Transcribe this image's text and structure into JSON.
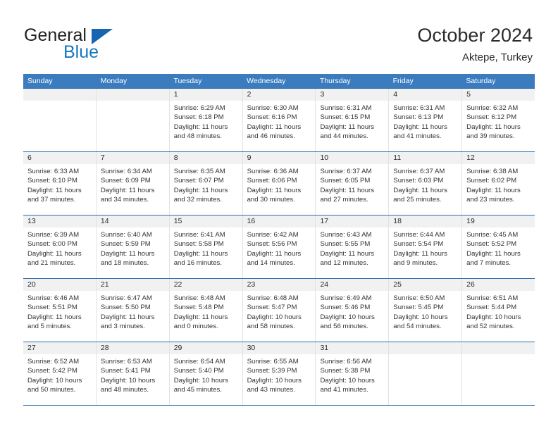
{
  "brand": {
    "name_top": "General",
    "name_bottom": "Blue"
  },
  "header": {
    "title": "October 2024",
    "subtitle": "Aktepe, Turkey"
  },
  "colors": {
    "header_blue": "#3b7cbf",
    "row_divider_blue": "#2f6daf",
    "daynum_background": "#f1f1f1",
    "logo_blue": "#1677bd",
    "text": "#333333"
  },
  "weekdays": [
    "Sunday",
    "Monday",
    "Tuesday",
    "Wednesday",
    "Thursday",
    "Friday",
    "Saturday"
  ],
  "labels": {
    "sunrise_prefix": "Sunrise: ",
    "sunset_prefix": "Sunset: ",
    "daylight_prefix": "Daylight: "
  },
  "weeks": [
    [
      {
        "day": "",
        "empty": true
      },
      {
        "day": "",
        "empty": true
      },
      {
        "day": "1",
        "sunrise": "Sunrise: 6:29 AM",
        "sunset": "Sunset: 6:18 PM",
        "daylight1": "Daylight: 11 hours",
        "daylight2": "and 48 minutes."
      },
      {
        "day": "2",
        "sunrise": "Sunrise: 6:30 AM",
        "sunset": "Sunset: 6:16 PM",
        "daylight1": "Daylight: 11 hours",
        "daylight2": "and 46 minutes."
      },
      {
        "day": "3",
        "sunrise": "Sunrise: 6:31 AM",
        "sunset": "Sunset: 6:15 PM",
        "daylight1": "Daylight: 11 hours",
        "daylight2": "and 44 minutes."
      },
      {
        "day": "4",
        "sunrise": "Sunrise: 6:31 AM",
        "sunset": "Sunset: 6:13 PM",
        "daylight1": "Daylight: 11 hours",
        "daylight2": "and 41 minutes."
      },
      {
        "day": "5",
        "sunrise": "Sunrise: 6:32 AM",
        "sunset": "Sunset: 6:12 PM",
        "daylight1": "Daylight: 11 hours",
        "daylight2": "and 39 minutes."
      }
    ],
    [
      {
        "day": "6",
        "sunrise": "Sunrise: 6:33 AM",
        "sunset": "Sunset: 6:10 PM",
        "daylight1": "Daylight: 11 hours",
        "daylight2": "and 37 minutes."
      },
      {
        "day": "7",
        "sunrise": "Sunrise: 6:34 AM",
        "sunset": "Sunset: 6:09 PM",
        "daylight1": "Daylight: 11 hours",
        "daylight2": "and 34 minutes."
      },
      {
        "day": "8",
        "sunrise": "Sunrise: 6:35 AM",
        "sunset": "Sunset: 6:07 PM",
        "daylight1": "Daylight: 11 hours",
        "daylight2": "and 32 minutes."
      },
      {
        "day": "9",
        "sunrise": "Sunrise: 6:36 AM",
        "sunset": "Sunset: 6:06 PM",
        "daylight1": "Daylight: 11 hours",
        "daylight2": "and 30 minutes."
      },
      {
        "day": "10",
        "sunrise": "Sunrise: 6:37 AM",
        "sunset": "Sunset: 6:05 PM",
        "daylight1": "Daylight: 11 hours",
        "daylight2": "and 27 minutes."
      },
      {
        "day": "11",
        "sunrise": "Sunrise: 6:37 AM",
        "sunset": "Sunset: 6:03 PM",
        "daylight1": "Daylight: 11 hours",
        "daylight2": "and 25 minutes."
      },
      {
        "day": "12",
        "sunrise": "Sunrise: 6:38 AM",
        "sunset": "Sunset: 6:02 PM",
        "daylight1": "Daylight: 11 hours",
        "daylight2": "and 23 minutes."
      }
    ],
    [
      {
        "day": "13",
        "sunrise": "Sunrise: 6:39 AM",
        "sunset": "Sunset: 6:00 PM",
        "daylight1": "Daylight: 11 hours",
        "daylight2": "and 21 minutes."
      },
      {
        "day": "14",
        "sunrise": "Sunrise: 6:40 AM",
        "sunset": "Sunset: 5:59 PM",
        "daylight1": "Daylight: 11 hours",
        "daylight2": "and 18 minutes."
      },
      {
        "day": "15",
        "sunrise": "Sunrise: 6:41 AM",
        "sunset": "Sunset: 5:58 PM",
        "daylight1": "Daylight: 11 hours",
        "daylight2": "and 16 minutes."
      },
      {
        "day": "16",
        "sunrise": "Sunrise: 6:42 AM",
        "sunset": "Sunset: 5:56 PM",
        "daylight1": "Daylight: 11 hours",
        "daylight2": "and 14 minutes."
      },
      {
        "day": "17",
        "sunrise": "Sunrise: 6:43 AM",
        "sunset": "Sunset: 5:55 PM",
        "daylight1": "Daylight: 11 hours",
        "daylight2": "and 12 minutes."
      },
      {
        "day": "18",
        "sunrise": "Sunrise: 6:44 AM",
        "sunset": "Sunset: 5:54 PM",
        "daylight1": "Daylight: 11 hours",
        "daylight2": "and 9 minutes."
      },
      {
        "day": "19",
        "sunrise": "Sunrise: 6:45 AM",
        "sunset": "Sunset: 5:52 PM",
        "daylight1": "Daylight: 11 hours",
        "daylight2": "and 7 minutes."
      }
    ],
    [
      {
        "day": "20",
        "sunrise": "Sunrise: 6:46 AM",
        "sunset": "Sunset: 5:51 PM",
        "daylight1": "Daylight: 11 hours",
        "daylight2": "and 5 minutes."
      },
      {
        "day": "21",
        "sunrise": "Sunrise: 6:47 AM",
        "sunset": "Sunset: 5:50 PM",
        "daylight1": "Daylight: 11 hours",
        "daylight2": "and 3 minutes."
      },
      {
        "day": "22",
        "sunrise": "Sunrise: 6:48 AM",
        "sunset": "Sunset: 5:48 PM",
        "daylight1": "Daylight: 11 hours",
        "daylight2": "and 0 minutes."
      },
      {
        "day": "23",
        "sunrise": "Sunrise: 6:48 AM",
        "sunset": "Sunset: 5:47 PM",
        "daylight1": "Daylight: 10 hours",
        "daylight2": "and 58 minutes."
      },
      {
        "day": "24",
        "sunrise": "Sunrise: 6:49 AM",
        "sunset": "Sunset: 5:46 PM",
        "daylight1": "Daylight: 10 hours",
        "daylight2": "and 56 minutes."
      },
      {
        "day": "25",
        "sunrise": "Sunrise: 6:50 AM",
        "sunset": "Sunset: 5:45 PM",
        "daylight1": "Daylight: 10 hours",
        "daylight2": "and 54 minutes."
      },
      {
        "day": "26",
        "sunrise": "Sunrise: 6:51 AM",
        "sunset": "Sunset: 5:44 PM",
        "daylight1": "Daylight: 10 hours",
        "daylight2": "and 52 minutes."
      }
    ],
    [
      {
        "day": "27",
        "sunrise": "Sunrise: 6:52 AM",
        "sunset": "Sunset: 5:42 PM",
        "daylight1": "Daylight: 10 hours",
        "daylight2": "and 50 minutes."
      },
      {
        "day": "28",
        "sunrise": "Sunrise: 6:53 AM",
        "sunset": "Sunset: 5:41 PM",
        "daylight1": "Daylight: 10 hours",
        "daylight2": "and 48 minutes."
      },
      {
        "day": "29",
        "sunrise": "Sunrise: 6:54 AM",
        "sunset": "Sunset: 5:40 PM",
        "daylight1": "Daylight: 10 hours",
        "daylight2": "and 45 minutes."
      },
      {
        "day": "30",
        "sunrise": "Sunrise: 6:55 AM",
        "sunset": "Sunset: 5:39 PM",
        "daylight1": "Daylight: 10 hours",
        "daylight2": "and 43 minutes."
      },
      {
        "day": "31",
        "sunrise": "Sunrise: 6:56 AM",
        "sunset": "Sunset: 5:38 PM",
        "daylight1": "Daylight: 10 hours",
        "daylight2": "and 41 minutes."
      },
      {
        "day": "",
        "empty": true
      },
      {
        "day": "",
        "empty": true
      }
    ]
  ]
}
